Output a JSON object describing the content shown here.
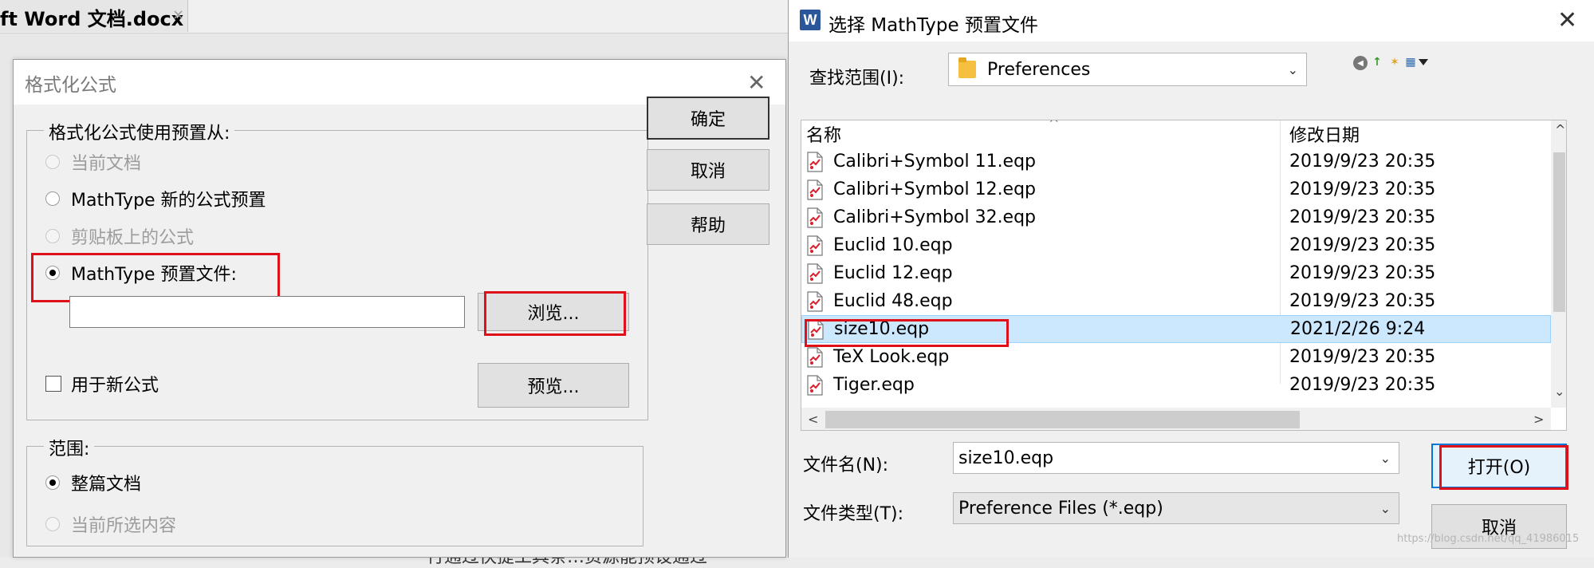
{
  "word": {
    "tab_title": "ft Word 文档.docx",
    "tab_close": "×",
    "bottom_text": "行通过快捷工具条…资源能预设通过"
  },
  "format_dialog": {
    "title": "格式化公式",
    "close": "✕",
    "group_label": "格式化公式使用预置从:",
    "options": [
      {
        "label": "当前文档",
        "checked": false,
        "disabled": true
      },
      {
        "label": "MathType 新的公式预置",
        "checked": false,
        "disabled": false
      },
      {
        "label": "剪贴板上的公式",
        "checked": false,
        "disabled": true
      },
      {
        "label": "MathType 预置文件:",
        "checked": true,
        "disabled": false
      }
    ],
    "file_path_value": "",
    "browse_label": "浏览...",
    "new_formula_label": "用于新公式",
    "preview_label": "预览...",
    "ok_label": "确定",
    "cancel_label": "取消",
    "help_label": "帮助",
    "scope_label": "范围:",
    "scope_options": [
      {
        "label": "整篇文档",
        "checked": true,
        "disabled": false
      },
      {
        "label": "当前所选内容",
        "checked": false,
        "disabled": true
      }
    ]
  },
  "file_dialog": {
    "app_icon": "W",
    "title": "选择 MathType 预置文件",
    "close": "✕",
    "lookin_label": "查找范围(I):",
    "lookin_value": "Preferences",
    "col_name": "名称",
    "col_date": "修改日期",
    "sort_arrow": "^",
    "files": [
      {
        "name": "Calibri+Symbol 11.eqp",
        "date": "2019/9/23 20:35",
        "selected": false
      },
      {
        "name": "Calibri+Symbol 12.eqp",
        "date": "2019/9/23 20:35",
        "selected": false
      },
      {
        "name": "Calibri+Symbol 32.eqp",
        "date": "2019/9/23 20:35",
        "selected": false
      },
      {
        "name": "Euclid 10.eqp",
        "date": "2019/9/23 20:35",
        "selected": false
      },
      {
        "name": "Euclid 12.eqp",
        "date": "2019/9/23 20:35",
        "selected": false
      },
      {
        "name": "Euclid 48.eqp",
        "date": "2019/9/23 20:35",
        "selected": false
      },
      {
        "name": "size10.eqp",
        "date": "2021/2/26 9:24",
        "selected": true
      },
      {
        "name": "TeX Look.eqp",
        "date": "2019/9/23 20:35",
        "selected": false
      },
      {
        "name": "Tiger.eqp",
        "date": "2019/9/23 20:35",
        "selected": false
      }
    ],
    "filename_label": "文件名(N):",
    "filename_value": "size10.eqp",
    "filetype_label": "文件类型(T):",
    "filetype_value": "Preference Files (*.eqp)",
    "open_label": "打开(O)",
    "cancel_label": "取消",
    "watermark": "https://blog.csdn.net/qq_41986015"
  },
  "icons": {
    "chevron_down": "⌄",
    "scroll_up": "^",
    "scroll_down": "⌄",
    "scroll_left": "<",
    "scroll_right": ">",
    "back": "◀",
    "up_folder": "↑",
    "new_folder": "✶",
    "view_menu": "▦"
  },
  "colors": {
    "accent_red": "#e0101a",
    "selection": "#cce8ff",
    "word_blue": "#2b579a"
  }
}
